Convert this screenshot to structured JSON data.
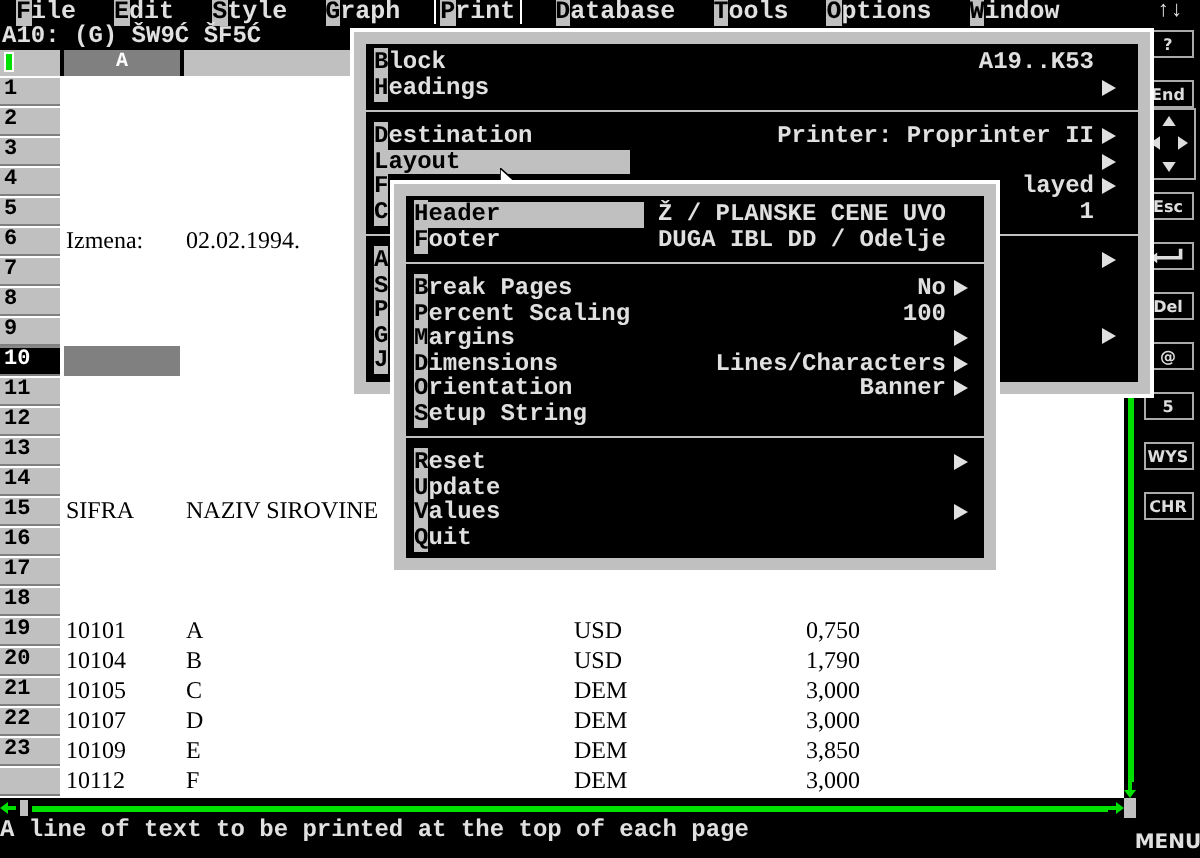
{
  "menu_bar": {
    "items": [
      {
        "label": "File",
        "selected": false
      },
      {
        "label": "Edit",
        "selected": false
      },
      {
        "label": "Style",
        "selected": false
      },
      {
        "label": "Graph",
        "selected": false
      },
      {
        "label": "Print",
        "selected": true
      },
      {
        "label": "Database",
        "selected": false
      },
      {
        "label": "Tools",
        "selected": false
      },
      {
        "label": "Options",
        "selected": false
      },
      {
        "label": "Window",
        "selected": false
      }
    ],
    "scroll_arrows": "↑↓"
  },
  "status_line": "A10: (G) ŠW9Ć ŠF5Ć",
  "columns": [
    {
      "label": "A",
      "selected": true
    }
  ],
  "rows": [
    {
      "number": "1",
      "selected": false,
      "cells": []
    },
    {
      "number": "2",
      "selected": false,
      "cells": []
    },
    {
      "number": "3",
      "selected": false,
      "cells": []
    },
    {
      "number": "4",
      "selected": false,
      "cells": []
    },
    {
      "number": "5",
      "selected": false,
      "cells": []
    },
    {
      "number": "6",
      "selected": false,
      "cells": [
        "Izmena:",
        "02.02.1994."
      ]
    },
    {
      "number": "7",
      "selected": false,
      "cells": []
    },
    {
      "number": "8",
      "selected": false,
      "cells": []
    },
    {
      "number": "9",
      "selected": false,
      "cells": []
    },
    {
      "number": "10",
      "selected": true,
      "cells": []
    },
    {
      "number": "11",
      "selected": false,
      "cells": []
    },
    {
      "number": "12",
      "selected": false,
      "cells": []
    },
    {
      "number": "13",
      "selected": false,
      "cells": []
    },
    {
      "number": "14",
      "selected": false,
      "cells": []
    },
    {
      "number": "15",
      "selected": false,
      "cells": [
        "SIFRA",
        "NAZIV SIROVINE"
      ]
    },
    {
      "number": "16",
      "selected": false,
      "cells": []
    },
    {
      "number": "17",
      "selected": false,
      "cells": []
    },
    {
      "number": "18",
      "selected": false,
      "cells": []
    },
    {
      "number": "19",
      "selected": false,
      "cells": [
        "10101",
        "A",
        "USD",
        "0,750"
      ]
    },
    {
      "number": "20",
      "selected": false,
      "cells": [
        "10104",
        "B",
        "USD",
        "1,790"
      ]
    },
    {
      "number": "21",
      "selected": false,
      "cells": [
        "10105",
        "C",
        "DEM",
        "3,000"
      ]
    },
    {
      "number": "22",
      "selected": false,
      "cells": [
        "10107",
        "D",
        "DEM",
        "3,000"
      ]
    },
    {
      "number": "23",
      "selected": false,
      "cells": [
        "10109",
        "E",
        "DEM",
        "3,850"
      ]
    },
    {
      "selected": false,
      "cells": [
        "10112",
        "F",
        "DEM",
        "3,000"
      ]
    }
  ],
  "print_menu": {
    "items": [
      {
        "kind": "item",
        "label": "Block",
        "value": "A19..K53",
        "submenu": false,
        "selected": false
      },
      {
        "kind": "item",
        "label": "Headings",
        "submenu": true,
        "selected": false
      },
      {
        "kind": "divider"
      },
      {
        "kind": "item",
        "label": "Destination",
        "value": "Printer: Proprinter II",
        "submenu": true,
        "selected": false
      },
      {
        "kind": "item",
        "label": "Layout",
        "submenu": true,
        "selected": true
      },
      {
        "kind": "item",
        "label": "F",
        "value": "layed",
        "submenu": true,
        "selected": false
      },
      {
        "kind": "item",
        "label": "C",
        "value": "1",
        "submenu": false,
        "selected": false
      },
      {
        "kind": "divider"
      },
      {
        "kind": "item",
        "label": "A",
        "submenu": true,
        "selected": false
      },
      {
        "kind": "item",
        "label": "S",
        "submenu": false,
        "selected": false
      },
      {
        "kind": "item",
        "label": "P",
        "submenu": false,
        "selected": false
      },
      {
        "kind": "item",
        "label": "G",
        "submenu": true,
        "selected": false
      },
      {
        "kind": "item",
        "label": "J",
        "submenu": false,
        "selected": false
      }
    ]
  },
  "layout_menu": {
    "items": [
      {
        "kind": "item",
        "label": "Header",
        "value": "Ž / PLANSKE CENE UVO",
        "submenu": false,
        "selected": true
      },
      {
        "kind": "item",
        "label": "Footer",
        "value": "DUGA IBL DD / Odelje",
        "submenu": false,
        "selected": false
      },
      {
        "kind": "divider"
      },
      {
        "kind": "item",
        "label": "Break Pages",
        "value": "No",
        "submenu": true,
        "selected": false
      },
      {
        "kind": "item",
        "label": "Percent Scaling",
        "value": "100",
        "submenu": false,
        "selected": false
      },
      {
        "kind": "item",
        "label": "Margins",
        "submenu": true,
        "selected": false
      },
      {
        "kind": "item",
        "label": "Dimensions",
        "value": "Lines/Characters",
        "submenu": true,
        "selected": false
      },
      {
        "kind": "item",
        "label": "Orientation",
        "value": "Banner",
        "submenu": true,
        "selected": false
      },
      {
        "kind": "item",
        "label": "Setup String",
        "submenu": false,
        "selected": false
      },
      {
        "kind": "divider"
      },
      {
        "kind": "item",
        "label": "Reset",
        "submenu": true,
        "selected": false
      },
      {
        "kind": "item",
        "label": "Update",
        "submenu": false,
        "selected": false
      },
      {
        "kind": "item",
        "label": "Values",
        "submenu": true,
        "selected": false
      },
      {
        "kind": "item",
        "label": "Quit",
        "submenu": false,
        "selected": false
      }
    ]
  },
  "side_panel": [
    {
      "kind": "key",
      "label": "?"
    },
    {
      "kind": "key",
      "label": "End"
    },
    {
      "kind": "arrows"
    },
    {
      "kind": "key",
      "label": "Esc"
    },
    {
      "kind": "enter"
    },
    {
      "kind": "key",
      "label": "Del"
    },
    {
      "kind": "key",
      "label": "@"
    },
    {
      "kind": "key",
      "label": "5"
    },
    {
      "kind": "key",
      "label": "WYS"
    },
    {
      "kind": "key",
      "label": "CHR"
    }
  ],
  "prompt": "A line of text to be printed at the top of each page",
  "mode": "MENU"
}
